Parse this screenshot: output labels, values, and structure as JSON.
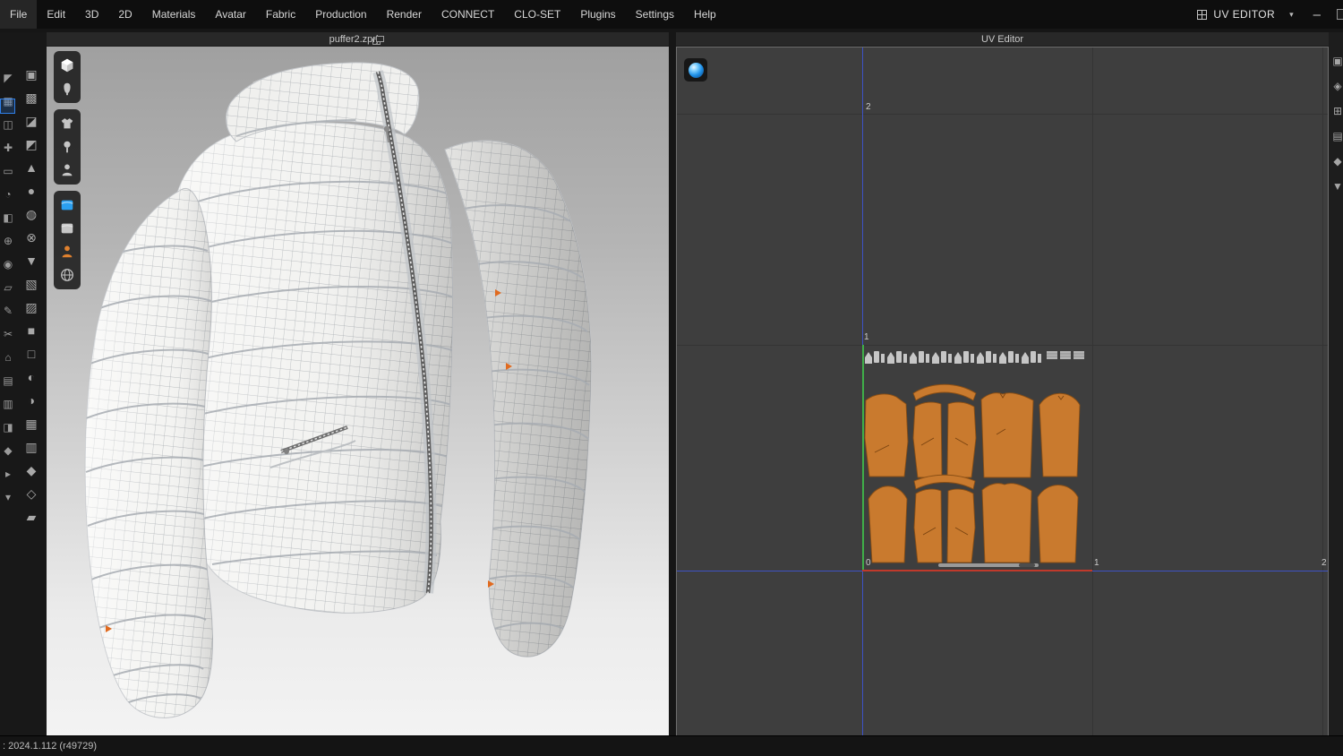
{
  "menu": {
    "items": [
      "File",
      "Edit",
      "3D",
      "2D",
      "Materials",
      "Avatar",
      "Fabric",
      "Production",
      "Render",
      "CONNECT",
      "CLO-SET",
      "Plugins",
      "Settings",
      "Help"
    ],
    "right": {
      "panel_label": "UV EDITOR",
      "caret": "▾",
      "minimize": "–"
    }
  },
  "left_toolbar": {
    "col1": [
      "◤",
      "▦",
      "◫",
      "✚",
      "▭",
      "◔",
      "◧",
      "⊕",
      "◉",
      "▱",
      "✎",
      "✂",
      "⌂",
      "▤",
      "▥",
      "◨",
      "◆",
      "▸",
      "▾"
    ],
    "col2": [
      "▣",
      "▩",
      "◪",
      "◩",
      "▲",
      "●",
      "◍",
      "⊗",
      "▼",
      "▧",
      "▨",
      "■",
      "□",
      "◐",
      "◑",
      "▦",
      "▥",
      "◆",
      "◇",
      "▰"
    ]
  },
  "right_toolbar": {
    "icons": [
      "▣",
      "◈",
      "⊞",
      "▤",
      "◆",
      "▼"
    ]
  },
  "viewport": {
    "title": "puffer2.zprj"
  },
  "viewport_tools": {
    "groups": [
      [
        "cube-3d-view-icon",
        "dress-form-icon"
      ],
      [
        "garment-shirt-icon",
        "pin-icon",
        "avatar-icon"
      ],
      [
        "fabric-swatch-blue-icon",
        "fabric-swatch-gray-icon",
        "avatar-orange-icon",
        "globe-icon"
      ]
    ]
  },
  "uv": {
    "title": "UV Editor",
    "ticks": {
      "v2": "2",
      "v1": "1",
      "origin": "0",
      "u1": "1",
      "u2": "2"
    }
  },
  "status": {
    "text": ": 2024.1.112 (r49729)"
  },
  "colors": {
    "accent_blue": "#2f7fe8",
    "uv_pattern_orange": "#c97a2e",
    "axis_green": "#3fae49",
    "axis_red": "#c0392b",
    "axis_blue": "#3d52c4",
    "sphere_blue": "#1e90e8"
  }
}
